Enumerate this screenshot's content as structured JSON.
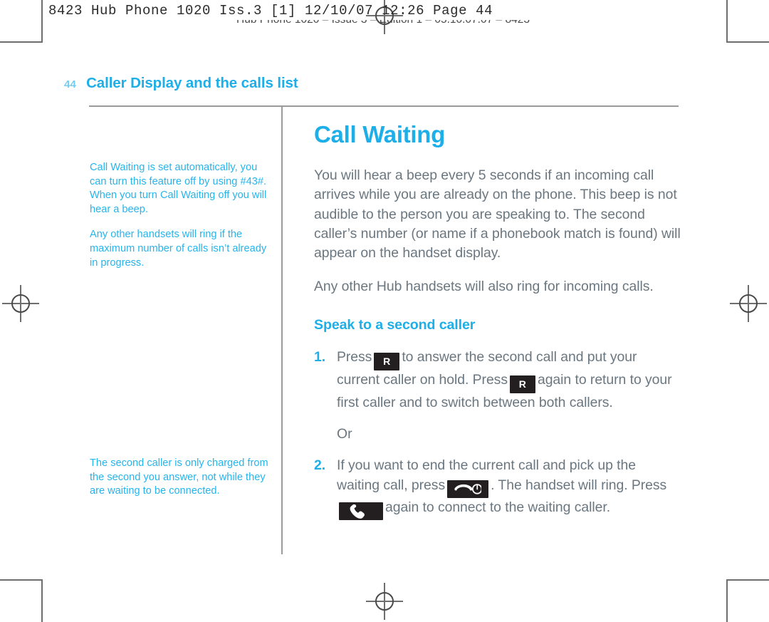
{
  "slug": {
    "primary": "8423 Hub Phone 1020 Iss.3 [1]  12/10/07  12:26  Page 44",
    "secondary": "Hub Phone 1020 – Issue 3 – Edition 1 – 05.10.07.07 – 8423"
  },
  "running_head": {
    "folio": "44",
    "title": "Caller Display and the calls list"
  },
  "sidenotes": {
    "upper": [
      "Call Waiting is set automatically, you can turn this feature off by using #43#. When you turn Call Waiting off you will hear a beep.",
      "Any other handsets will ring if the maximum number of calls isn’t already in progress."
    ],
    "lower": "The second caller is only charged from the second you answer, not while they are waiting to be connected."
  },
  "main": {
    "title": "Call Waiting",
    "paragraphs": [
      "You will hear a beep every 5 seconds if an incoming call arrives while you are already on the phone. This beep is not audible to the person you are speaking to. The second caller’s number (or name if a phonebook match is found) will appear on the handset display.",
      "Any other Hub handsets will also ring for incoming calls."
    ],
    "subheading": "Speak to a second caller",
    "steps": [
      {
        "number": "1.",
        "text_1": "Press",
        "key_1": "R",
        "text_2": "to answer the second call and put your current caller on hold. Press",
        "key_2": "R",
        "text_3": "again to return to your first caller and to switch between both callers."
      },
      {
        "number": "2.",
        "text_1": "If you want to end the current call and pick up the waiting call, press",
        "key_1": "end-call-icon",
        "text_2": ". The handset will ring. Press",
        "key_2": "answer-call-icon",
        "text_3": "again to connect to the waiting caller."
      }
    ],
    "or_label": "Or"
  },
  "colors": {
    "accent_blue": "#1eaee8",
    "note_blue": "#26b4ec",
    "folio_blue": "#74cdf0",
    "body_grey": "#6b7780",
    "rule_grey": "#9a9a9a",
    "keycap_black": "#231f20"
  }
}
